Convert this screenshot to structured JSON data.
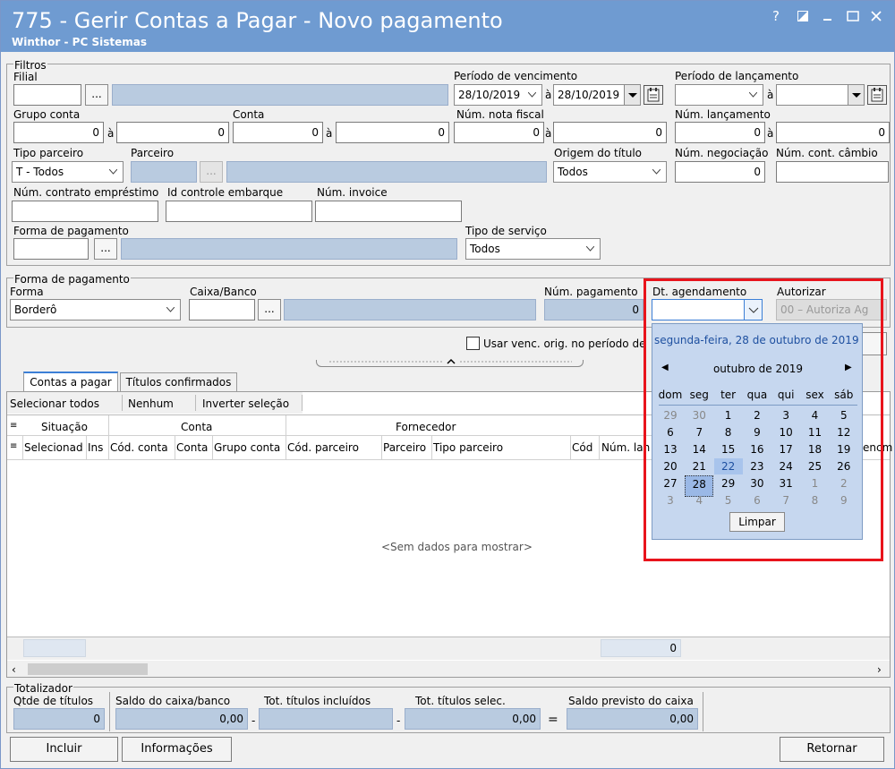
{
  "window": {
    "title": "775 - Gerir Contas a Pagar - Novo pagamento",
    "subtitle": "Winthor - PC Sistemas",
    "help": "?"
  },
  "filtros": {
    "legend": "Filtros",
    "filial_label": "Filial",
    "periodo_venc_label": "Período  de vencimento",
    "periodo_venc_from": "28/10/2019",
    "periodo_venc_to": "28/10/2019",
    "periodo_lanc_label": "Período  de lançamento",
    "ate": "à",
    "grupo_conta_label": "Grupo conta",
    "grupo_from": "0",
    "grupo_to": "0",
    "conta_label": "Conta",
    "conta_from": "0",
    "conta_to": "0",
    "nota_label": "Núm. nota fiscal",
    "nota_from": "0",
    "nota_to": "0",
    "lanc_label": "Núm. lançamento",
    "lanc_from": "0",
    "lanc_to": "0",
    "tipo_parceiro_label": "Tipo parceiro",
    "tipo_parceiro_value": "T - Todos",
    "parceiro_label": "Parceiro",
    "origem_label": "Origem do título",
    "origem_value": "Todos",
    "negociacao_label": "Núm. negociação",
    "negociacao_value": "0",
    "cambio_label": "Núm. cont. câmbio",
    "emprestimo_label": "Núm. contrato empréstimo",
    "embarque_label": "Id controle embarque",
    "invoice_label": "Núm. invoice",
    "forma_label": "Forma de pagamento",
    "servico_label": "Tipo de serviço",
    "servico_value": "Todos",
    "ellipsis": "..."
  },
  "forma": {
    "legend": "Forma de pagamento",
    "forma_label": "Forma",
    "forma_value": "Borderô",
    "caixa_label": "Caixa/Banco",
    "num_pag_label": "Núm. pagamento",
    "num_pag_value": "0",
    "dt_agend_label": "Dt. agendamento",
    "autorizar_label": "Autorizar",
    "autorizar_value": "00 – Autoriza Ag"
  },
  "usar_venc": "Usar venc. orig. no período de",
  "tabs": [
    "Contas a pagar",
    "Títulos confirmados"
  ],
  "toolbar": [
    "Selecionar todos",
    "Nenhum",
    "Inverter seleção"
  ],
  "grid": {
    "groups": [
      "Situação",
      "Conta",
      "Fornecedor"
    ],
    "columns": [
      "Selecionad",
      "Ins",
      "Cód. conta",
      "Conta",
      "Grupo conta",
      "Cód. parceiro",
      "Parceiro",
      "Tipo parceiro",
      "Cód",
      "Núm. lan",
      "encm"
    ],
    "empty": "<Sem dados para mostrar>",
    "footer_total": "0"
  },
  "calendar": {
    "header": "segunda-feira, 28 de outubro de 2019",
    "month": "outubro de 2019",
    "weekdays": [
      "dom",
      "seg",
      "ter",
      "qua",
      "qui",
      "sex",
      "sáb"
    ],
    "weeks": [
      [
        "29",
        "30",
        "1",
        "2",
        "3",
        "4",
        "5"
      ],
      [
        "6",
        "7",
        "8",
        "9",
        "10",
        "11",
        "12"
      ],
      [
        "13",
        "14",
        "15",
        "16",
        "17",
        "18",
        "19"
      ],
      [
        "20",
        "21",
        "22",
        "23",
        "24",
        "25",
        "26"
      ],
      [
        "27",
        "28",
        "29",
        "30",
        "31",
        "1",
        "2"
      ],
      [
        "3",
        "4",
        "5",
        "6",
        "7",
        "8",
        "9"
      ]
    ],
    "clear": "Limpar"
  },
  "totalizador": {
    "legend": "Totalizador",
    "qtde_label": "Qtde de títulos",
    "qtde_value": "0",
    "saldo_label": "Saldo do caixa/banco",
    "saldo_value": "0,00",
    "incluidos_label": "Tot. títulos incluídos",
    "incluidos_value": "",
    "selec_label": "Tot. títulos selec.",
    "selec_value": "0,00",
    "previsto_label": "Saldo previsto do caixa",
    "previsto_value": "0,00",
    "minus": "-",
    "equals": "="
  },
  "buttons": {
    "incluir": "Incluir",
    "informacoes": "Informações",
    "retornar": "Retornar"
  }
}
